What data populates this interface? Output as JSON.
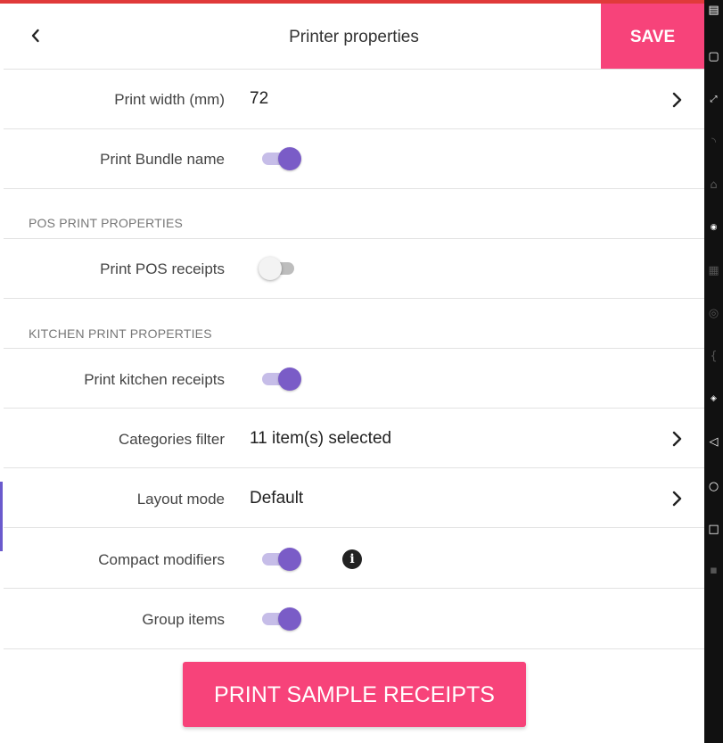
{
  "header": {
    "title": "Printer properties",
    "save_label": "SAVE",
    "back_icon": "chevron-left-icon"
  },
  "rows": {
    "print_width": {
      "label": "Print width (mm)",
      "value": "72"
    },
    "print_bundle_name": {
      "label": "Print Bundle name",
      "enabled": true
    },
    "pos_section": {
      "title": "POS PRINT PROPERTIES"
    },
    "print_pos_receipts": {
      "label": "Print POS receipts",
      "enabled": false
    },
    "kitchen_section": {
      "title": "KITCHEN PRINT PROPERTIES"
    },
    "print_kitchen_receipts": {
      "label": "Print kitchen receipts",
      "enabled": true
    },
    "categories_filter": {
      "label": "Categories filter",
      "value": "11 item(s) selected"
    },
    "layout_mode": {
      "label": "Layout mode",
      "value": "Default"
    },
    "compact_modifiers": {
      "label": "Compact modifiers",
      "enabled": true,
      "info_icon": "info-icon"
    },
    "group_items": {
      "label": "Group items",
      "enabled": true
    }
  },
  "print_button": {
    "label": "PRINT SAMPLE RECEIPTS"
  },
  "colors": {
    "accent": "#f7437a",
    "toggle_on": "#7a5cc7",
    "toggle_track_on": "#c6bde8",
    "toggle_off": "#bdbdbd"
  },
  "system_bar": {
    "icons": [
      "clipboard-icon",
      "screen-icon",
      "fullscreen-icon",
      "rss-icon",
      "home-icon",
      "gps-icon",
      "video-icon",
      "fingerprint-icon",
      "code-icon",
      "gamepad-icon",
      "back-icon",
      "circle-icon",
      "square-icon",
      "menu-icon"
    ]
  }
}
